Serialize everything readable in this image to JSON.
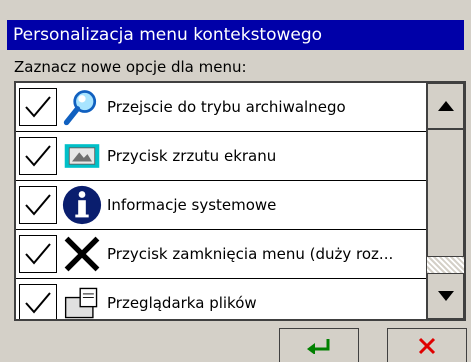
{
  "window": {
    "title": "Personalizacja menu kontekstowego"
  },
  "instruction": "Zaznacz nowe opcje dla menu:",
  "items": [
    {
      "label": "Przejscie do trybu archiwalnego",
      "checked": true,
      "icon": "magnifier-icon"
    },
    {
      "label": "Przycisk zrzutu ekranu",
      "checked": true,
      "icon": "screenshot-icon"
    },
    {
      "label": "Informacje systemowe",
      "checked": true,
      "icon": "info-icon"
    },
    {
      "label": "Przycisk zamknięcia menu (duży roz...",
      "checked": true,
      "icon": "close-x-icon"
    },
    {
      "label": "Przeglądarka plików",
      "checked": true,
      "icon": "file-browser-icon"
    }
  ],
  "buttons": {
    "ok_icon": "enter-arrow-icon",
    "cancel_icon": "close-icon"
  },
  "colors": {
    "titlebar": "#0000a8",
    "ok": "#008000",
    "cancel": "#e00000"
  }
}
